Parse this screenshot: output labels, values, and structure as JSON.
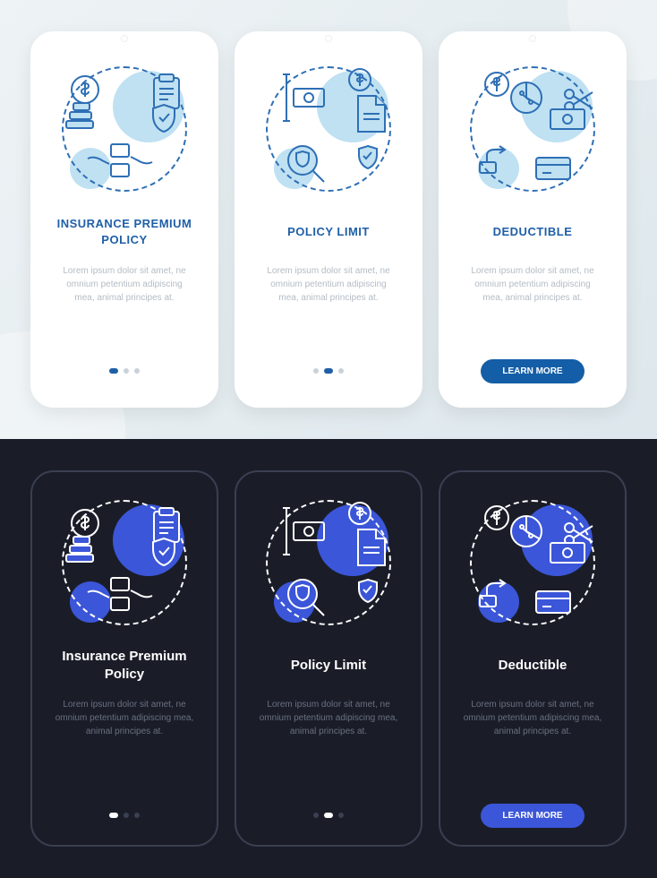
{
  "cta_label": "LEARN MORE",
  "lorem": "Lorem ipsum dolor sit amet, ne omnium petentium adipiscing mea, animal principes at.",
  "light": {
    "screens": [
      {
        "title": "INSURANCE PREMIUM POLICY",
        "active_dot": 0,
        "has_button": false,
        "illustration": "premium"
      },
      {
        "title": "POLICY LIMIT",
        "active_dot": 1,
        "has_button": false,
        "illustration": "limit"
      },
      {
        "title": "DEDUCTIBLE",
        "active_dot": 2,
        "has_button": true,
        "illustration": "deductible"
      }
    ]
  },
  "dark": {
    "screens": [
      {
        "title": "Insurance Premium Policy",
        "active_dot": 0,
        "has_button": false,
        "illustration": "premium"
      },
      {
        "title": "Policy Limit",
        "active_dot": 1,
        "has_button": false,
        "illustration": "limit"
      },
      {
        "title": "Deductible",
        "active_dot": 2,
        "has_button": true,
        "illustration": "deductible"
      }
    ]
  },
  "colors": {
    "light_accent": "#1f5fa8",
    "dark_accent": "#3b56d8",
    "light_bg": "#eef3f5",
    "dark_bg": "#1a1d28"
  }
}
